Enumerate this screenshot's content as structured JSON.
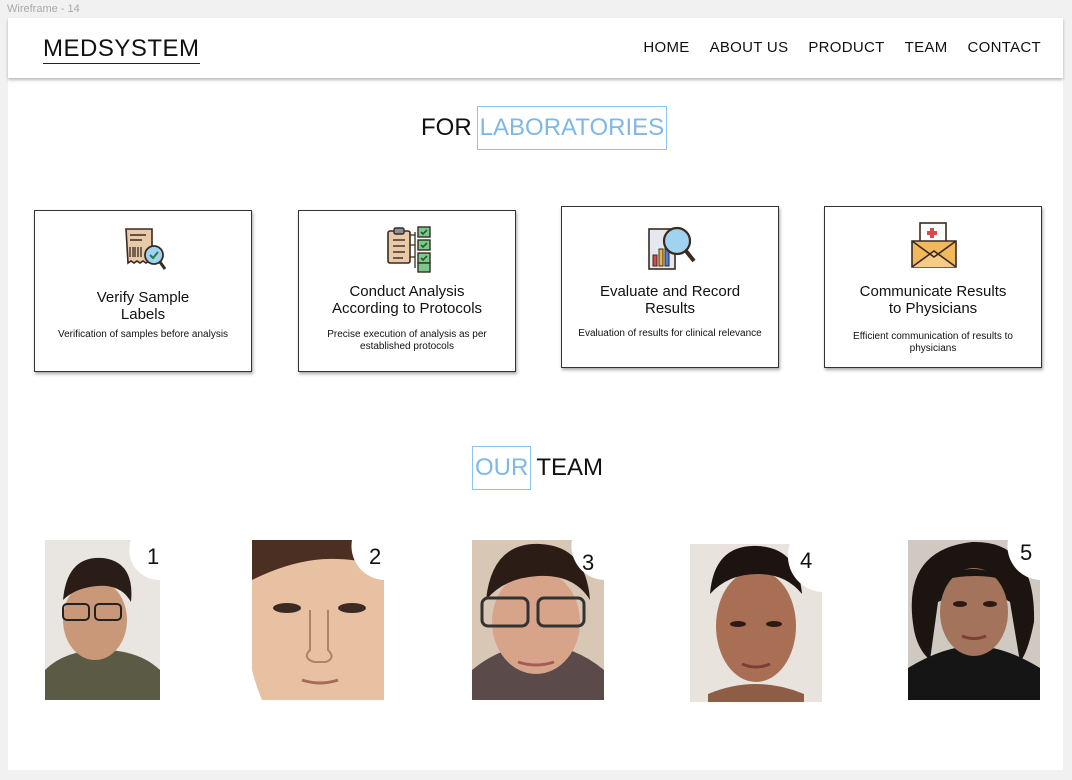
{
  "frame": {
    "label": "Wireframe - 14"
  },
  "brand": {
    "name": "MEDSYSTEM"
  },
  "nav": {
    "items": [
      {
        "label": "HOME"
      },
      {
        "label": "ABOUT US"
      },
      {
        "label": "PRODUCT"
      },
      {
        "label": "TEAM"
      },
      {
        "label": "CONTACT"
      }
    ]
  },
  "labs": {
    "title_prefix": "FOR",
    "title_highlight": "LABORATORIES"
  },
  "cards": [
    {
      "icon": "receipt-barcode-magnifier-icon",
      "title": "Verify Sample Labels",
      "title_line1": "Verify Sample",
      "title_line2": "Labels",
      "desc_line1": "Verification of samples before analysis",
      "desc_line2": ""
    },
    {
      "icon": "clipboard-checklist-icon",
      "title": "Conduct Analysis According to Protocols",
      "title_line1": "Conduct Analysis",
      "title_line2": "According to Protocols",
      "desc_line1": "Precise execution of analysis as per",
      "desc_line2": "established protocols"
    },
    {
      "icon": "bar-chart-magnifier-icon",
      "title": "Evaluate and Record Results",
      "title_line1": "Evaluate and Record",
      "title_line2": "Results",
      "desc_line1": "Evaluation of results for clinical relevance",
      "desc_line2": ""
    },
    {
      "icon": "medical-envelope-icon",
      "title": "Communicate Results to Physicians",
      "title_line1": "Communicate Results",
      "title_line2": "to Physicians",
      "desc_line1": "Efficient communication of results to",
      "desc_line2": "physicians"
    }
  ],
  "team": {
    "title_highlight": "OUR",
    "title_suffix": "TEAM",
    "members": [
      {
        "number": "1"
      },
      {
        "number": "2"
      },
      {
        "number": "3"
      },
      {
        "number": "4"
      },
      {
        "number": "5"
      }
    ]
  },
  "colors": {
    "accent": "#7fb8e6",
    "text": "#111111",
    "background": "#f1f1f1"
  }
}
